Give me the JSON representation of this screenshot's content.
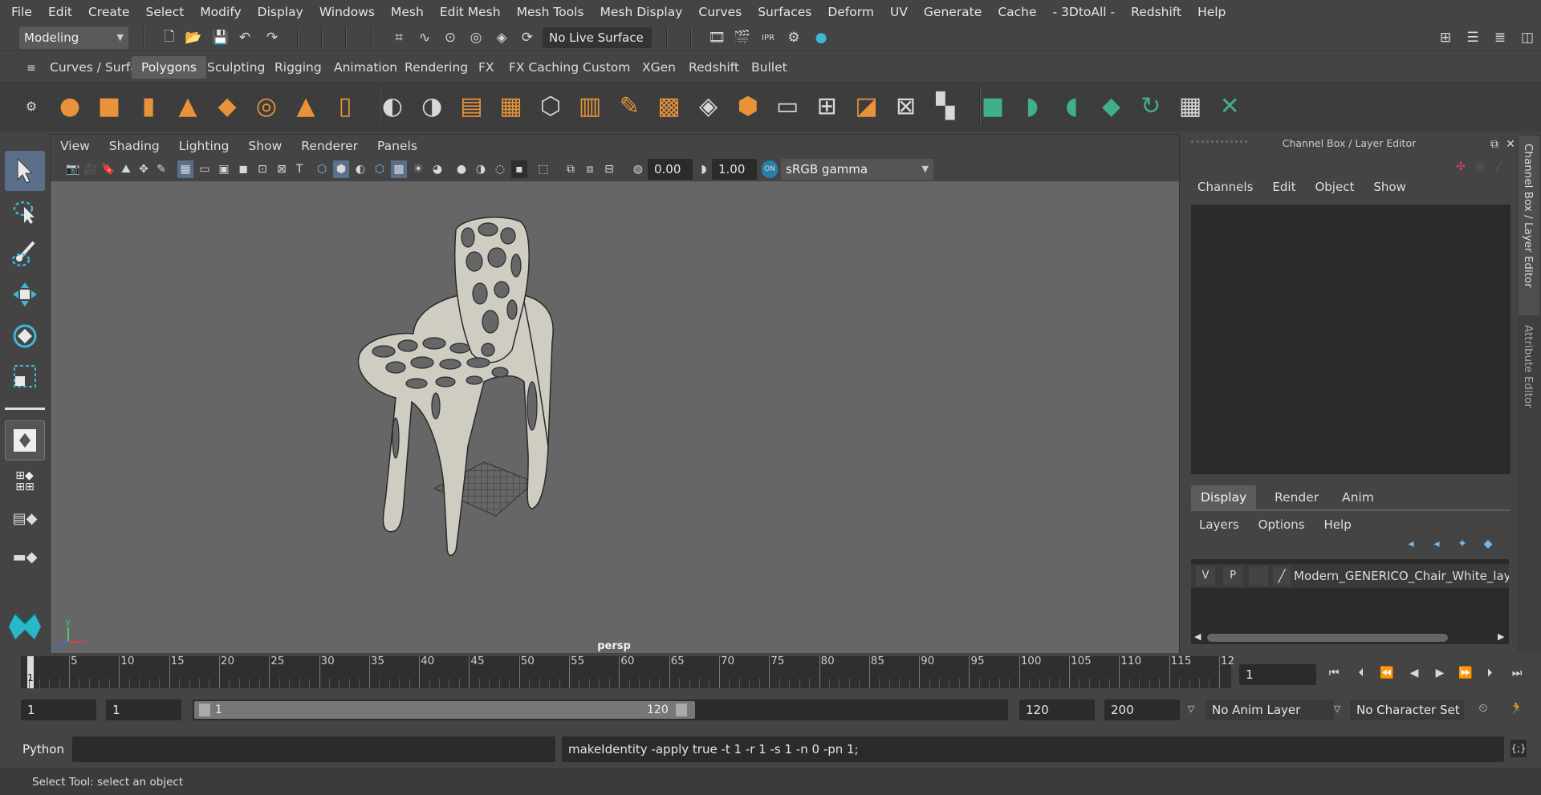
{
  "menubar": [
    "File",
    "Edit",
    "Create",
    "Select",
    "Modify",
    "Display",
    "Windows",
    "Mesh",
    "Edit Mesh",
    "Mesh Tools",
    "Mesh Display",
    "Curves",
    "Surfaces",
    "Deform",
    "UV",
    "Generate",
    "Cache",
    "- 3DtoAll -",
    "Redshift",
    "Help"
  ],
  "status": {
    "mode": "Modeling",
    "live_surface": "No Live Surface"
  },
  "shelf_tabs": [
    "Curves / Surfaces",
    "Polygons",
    "Sculpting",
    "Rigging",
    "Animation",
    "Rendering",
    "FX",
    "FX Caching",
    "Custom",
    "XGen",
    "Redshift",
    "Bullet"
  ],
  "shelf_active": "Polygons",
  "viewport": {
    "menu": [
      "View",
      "Shading",
      "Lighting",
      "Show",
      "Renderer",
      "Panels"
    ],
    "exposure": "0.00",
    "gamma": "1.00",
    "color_space": "sRGB gamma",
    "camera": "persp"
  },
  "channel_box": {
    "title": "Channel Box / Layer Editor",
    "menu": [
      "Channels",
      "Edit",
      "Object",
      "Show"
    ]
  },
  "layer_editor": {
    "tabs": [
      "Display",
      "Render",
      "Anim"
    ],
    "active_tab": "Display",
    "menu": [
      "Layers",
      "Options",
      "Help"
    ],
    "layer": {
      "v": "V",
      "p": "P",
      "name": "Modern_GENERICO_Chair_White_layer"
    }
  },
  "side_tabs": {
    "channel": "Channel Box / Layer Editor",
    "attribute": "Attribute Editor"
  },
  "timeline": {
    "ticks": [
      "5",
      "10",
      "15",
      "20",
      "25",
      "30",
      "35",
      "40",
      "45",
      "50",
      "55",
      "60",
      "65",
      "70",
      "75",
      "80",
      "85",
      "90",
      "95",
      "100",
      "105",
      "110",
      "115",
      "12"
    ],
    "current": "1",
    "frame_field": "1"
  },
  "range": {
    "start": "1",
    "playback_start": "1",
    "slider_start": "1",
    "slider_end": "120",
    "playback_end": "120",
    "end": "200",
    "anim_layer": "No Anim Layer",
    "char_set": "No Character Set"
  },
  "command": {
    "lang": "Python",
    "text": "makeIdentity -apply true -t 1 -r 1 -s 1 -n 0 -pn 1;"
  },
  "help_line": "Select Tool: select an object",
  "colors": {
    "accent": "#5b6f8a",
    "shelf_orange": "#e8933a",
    "shelf_teal": "#3fb08a"
  }
}
